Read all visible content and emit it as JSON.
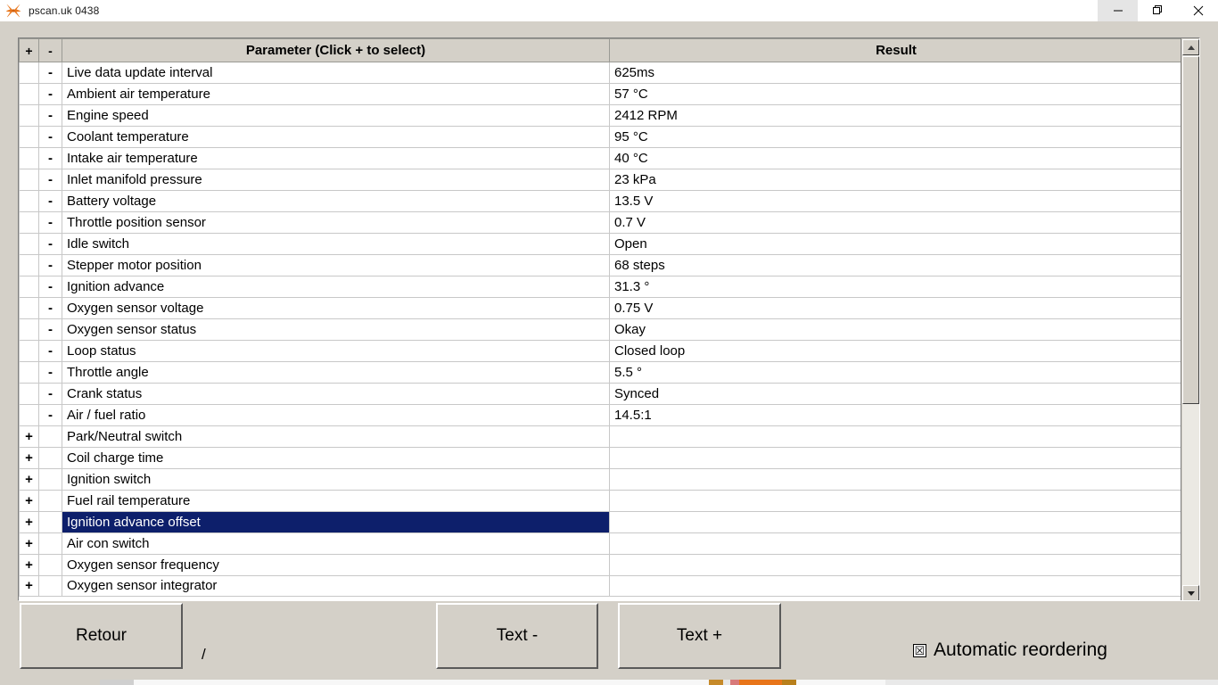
{
  "window": {
    "title": "pscan.uk 0438",
    "icon": "app-butterfly-icon",
    "controls": {
      "minimize": "minimize-icon",
      "maximize": "restore-icon",
      "close": "close-icon"
    }
  },
  "grid": {
    "headers": {
      "plus": "+",
      "minus": "-",
      "parameter": "Parameter (Click + to select)",
      "result": "Result"
    },
    "rows": [
      {
        "plus": "",
        "minus": "-",
        "parameter": "Live data update interval",
        "result": "625ms",
        "selected": false
      },
      {
        "plus": "",
        "minus": "-",
        "parameter": "Ambient air temperature",
        "result": "57 °C",
        "selected": false
      },
      {
        "plus": "",
        "minus": "-",
        "parameter": "Engine speed",
        "result": "2412 RPM",
        "selected": false
      },
      {
        "plus": "",
        "minus": "-",
        "parameter": "Coolant temperature",
        "result": "95 °C",
        "selected": false
      },
      {
        "plus": "",
        "minus": "-",
        "parameter": "Intake air temperature",
        "result": "40 °C",
        "selected": false
      },
      {
        "plus": "",
        "minus": "-",
        "parameter": "Inlet manifold pressure",
        "result": "23 kPa",
        "selected": false
      },
      {
        "plus": "",
        "minus": "-",
        "parameter": "Battery voltage",
        "result": "13.5 V",
        "selected": false
      },
      {
        "plus": "",
        "minus": "-",
        "parameter": "Throttle position sensor",
        "result": "0.7 V",
        "selected": false
      },
      {
        "plus": "",
        "minus": "-",
        "parameter": "Idle switch",
        "result": "Open",
        "selected": false
      },
      {
        "plus": "",
        "minus": "-",
        "parameter": "Stepper motor position",
        "result": "68 steps",
        "selected": false
      },
      {
        "plus": "",
        "minus": "-",
        "parameter": "Ignition advance",
        "result": "31.3 °",
        "selected": false
      },
      {
        "plus": "",
        "minus": "-",
        "parameter": "Oxygen sensor voltage",
        "result": "0.75 V",
        "selected": false
      },
      {
        "plus": "",
        "minus": "-",
        "parameter": "Oxygen sensor status",
        "result": "Okay",
        "selected": false
      },
      {
        "plus": "",
        "minus": "-",
        "parameter": "Loop status",
        "result": "Closed loop",
        "selected": false
      },
      {
        "plus": "",
        "minus": "-",
        "parameter": "Throttle angle",
        "result": "5.5 °",
        "selected": false
      },
      {
        "plus": "",
        "minus": "-",
        "parameter": "Crank status",
        "result": "Synced",
        "selected": false
      },
      {
        "plus": "",
        "minus": "-",
        "parameter": "Air / fuel ratio",
        "result": "14.5:1",
        "selected": false
      },
      {
        "plus": "+",
        "minus": "",
        "parameter": "Park/Neutral switch",
        "result": "",
        "selected": false
      },
      {
        "plus": "+",
        "minus": "",
        "parameter": "Coil charge time",
        "result": "",
        "selected": false
      },
      {
        "plus": "+",
        "minus": "",
        "parameter": "Ignition switch",
        "result": "",
        "selected": false
      },
      {
        "plus": "+",
        "minus": "",
        "parameter": "Fuel rail temperature",
        "result": "",
        "selected": false
      },
      {
        "plus": "+",
        "minus": "",
        "parameter": "Ignition advance offset",
        "result": "",
        "selected": true
      },
      {
        "plus": "+",
        "minus": "",
        "parameter": "Air con switch",
        "result": "",
        "selected": false
      },
      {
        "plus": "+",
        "minus": "",
        "parameter": "Oxygen sensor frequency",
        "result": "",
        "selected": false
      }
    ],
    "clipped_row": {
      "plus": "+",
      "minus": "",
      "parameter": "Oxygen sensor integrator",
      "result": ""
    }
  },
  "scrollbar": {
    "up_arrow": "scroll-up-arrow-icon",
    "down_arrow": "scroll-down-arrow-icon"
  },
  "footer": {
    "retour_label": "Retour",
    "separator_label": "/",
    "text_minus_label": "Text -",
    "text_plus_label": "Text +",
    "auto_reorder_label": "Automatic reordering",
    "auto_reorder_mark": "☒",
    "auto_reorder_checked": true
  },
  "colors": {
    "window_bg": "#d4d0c8",
    "grid_bg": "#ffffff",
    "selection": "#0d1f6b",
    "header_bg": "#d4d0c8",
    "icon_orange": "#e8751a"
  }
}
